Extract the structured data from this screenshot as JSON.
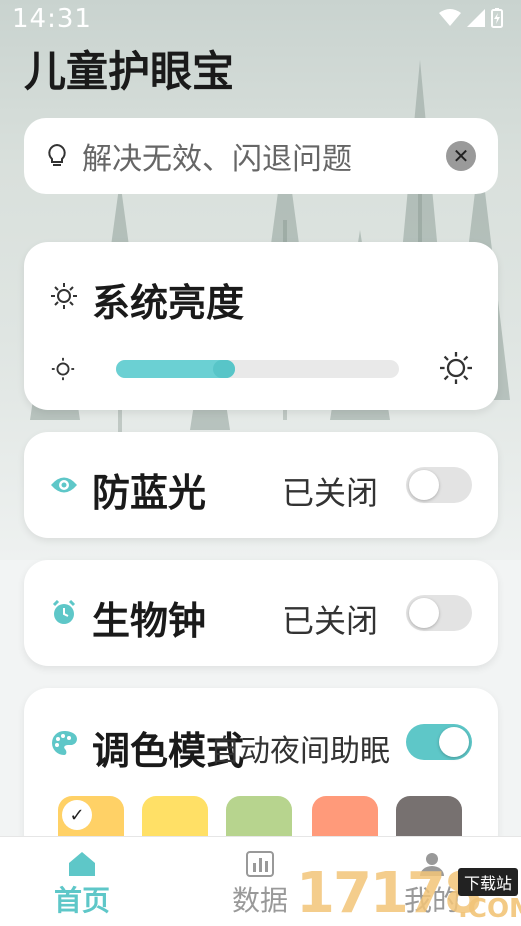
{
  "status": {
    "time": "14:31"
  },
  "app": {
    "title": "儿童护眼宝"
  },
  "tip": {
    "text": "解决无效、闪退问题",
    "close_glyph": "✕"
  },
  "brightness": {
    "title": "系统亮度",
    "level_fraction": 0.42
  },
  "blue_light": {
    "title": "防蓝光",
    "state": "已关闭",
    "on": false
  },
  "bio_clock": {
    "title": "生物钟",
    "state": "已关闭",
    "on": false
  },
  "color_mode": {
    "title": "调色模式",
    "night_label": "自动夜间助眠",
    "night_on": true,
    "swatches": [
      {
        "color": "#ffd166",
        "selected": true
      },
      {
        "color": "#ffe066",
        "selected": false
      },
      {
        "color": "#b7d48e",
        "selected": false
      },
      {
        "color": "#ff9a7a",
        "selected": false
      },
      {
        "color": "#777170",
        "selected": false
      }
    ],
    "check_glyph": "✓"
  },
  "tabbar": {
    "home_label": "首页",
    "data_label": "数据",
    "mine_label": "我的"
  },
  "watermark": {
    "text": "17178",
    "badge": "下载站",
    "suffix": ".COM"
  },
  "colors": {
    "accent": "#5ec7c8",
    "text": "#1a1a1a"
  }
}
